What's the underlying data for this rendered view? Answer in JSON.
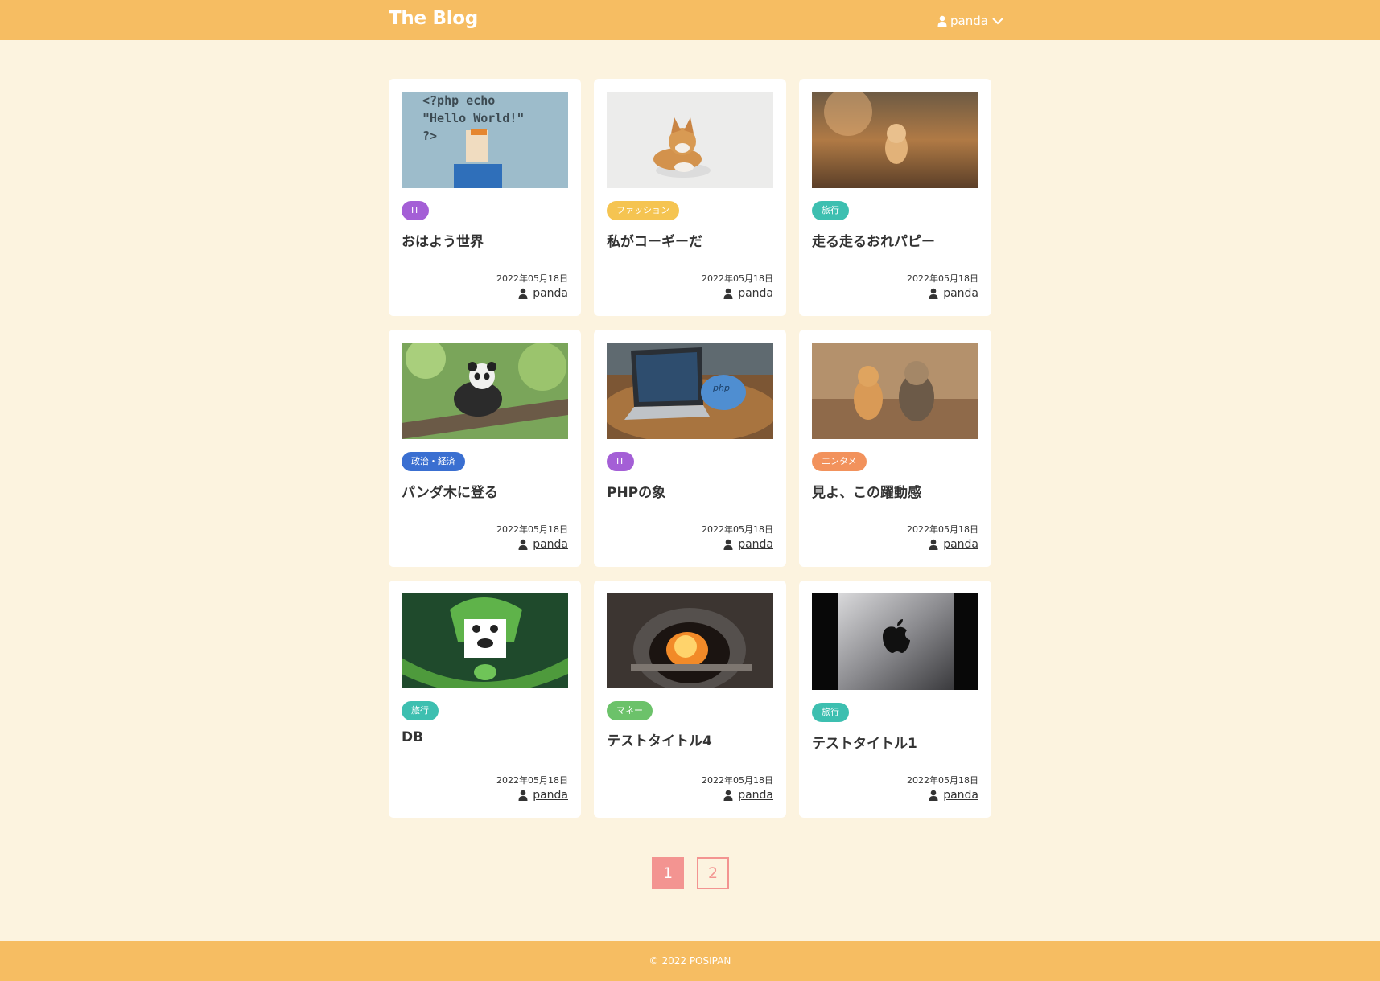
{
  "header": {
    "brand": "The Blog",
    "user_label": "panda"
  },
  "posts": [
    {
      "category": "IT",
      "category_color": "#a45fd6",
      "title": "おはよう世界",
      "date": "2022年05月18日",
      "author": "panda"
    },
    {
      "category": "ファッション",
      "category_color": "#f5c451",
      "title": "私がコーギーだ",
      "date": "2022年05月18日",
      "author": "panda"
    },
    {
      "category": "旅行",
      "category_color": "#3dbfb0",
      "title": "走る走るおれパピー",
      "date": "2022年05月18日",
      "author": "panda"
    },
    {
      "category": "政治・経済",
      "category_color": "#3a6fd1",
      "title": "パンダ木に登る",
      "date": "2022年05月18日",
      "author": "panda"
    },
    {
      "category": "IT",
      "category_color": "#a45fd6",
      "title": "PHPの象",
      "date": "2022年05月18日",
      "author": "panda"
    },
    {
      "category": "エンタメ",
      "category_color": "#f2925c",
      "title": "見よ、この躍動感",
      "date": "2022年05月18日",
      "author": "panda"
    },
    {
      "category": "旅行",
      "category_color": "#3dbfb0",
      "title": "DB",
      "date": "2022年05月18日",
      "author": "panda"
    },
    {
      "category": "マネー",
      "category_color": "#6cc26a",
      "title": "テストタイトル4",
      "date": "2022年05月18日",
      "author": "panda"
    },
    {
      "category": "旅行",
      "category_color": "#3dbfb0",
      "title": "テストタイトル1",
      "date": "2022年05月18日",
      "author": "panda"
    }
  ],
  "pagination": {
    "pages": [
      "1",
      "2"
    ],
    "current": "1"
  },
  "footer": {
    "copyright": "© 2022 POSIPAN"
  },
  "colors": {
    "header_bg": "#f6bd62",
    "page_bg": "#fcf3df",
    "pagination_accent": "#f39491"
  },
  "icons": {
    "user": "user-icon",
    "dropdown": "chevron-down-icon"
  }
}
